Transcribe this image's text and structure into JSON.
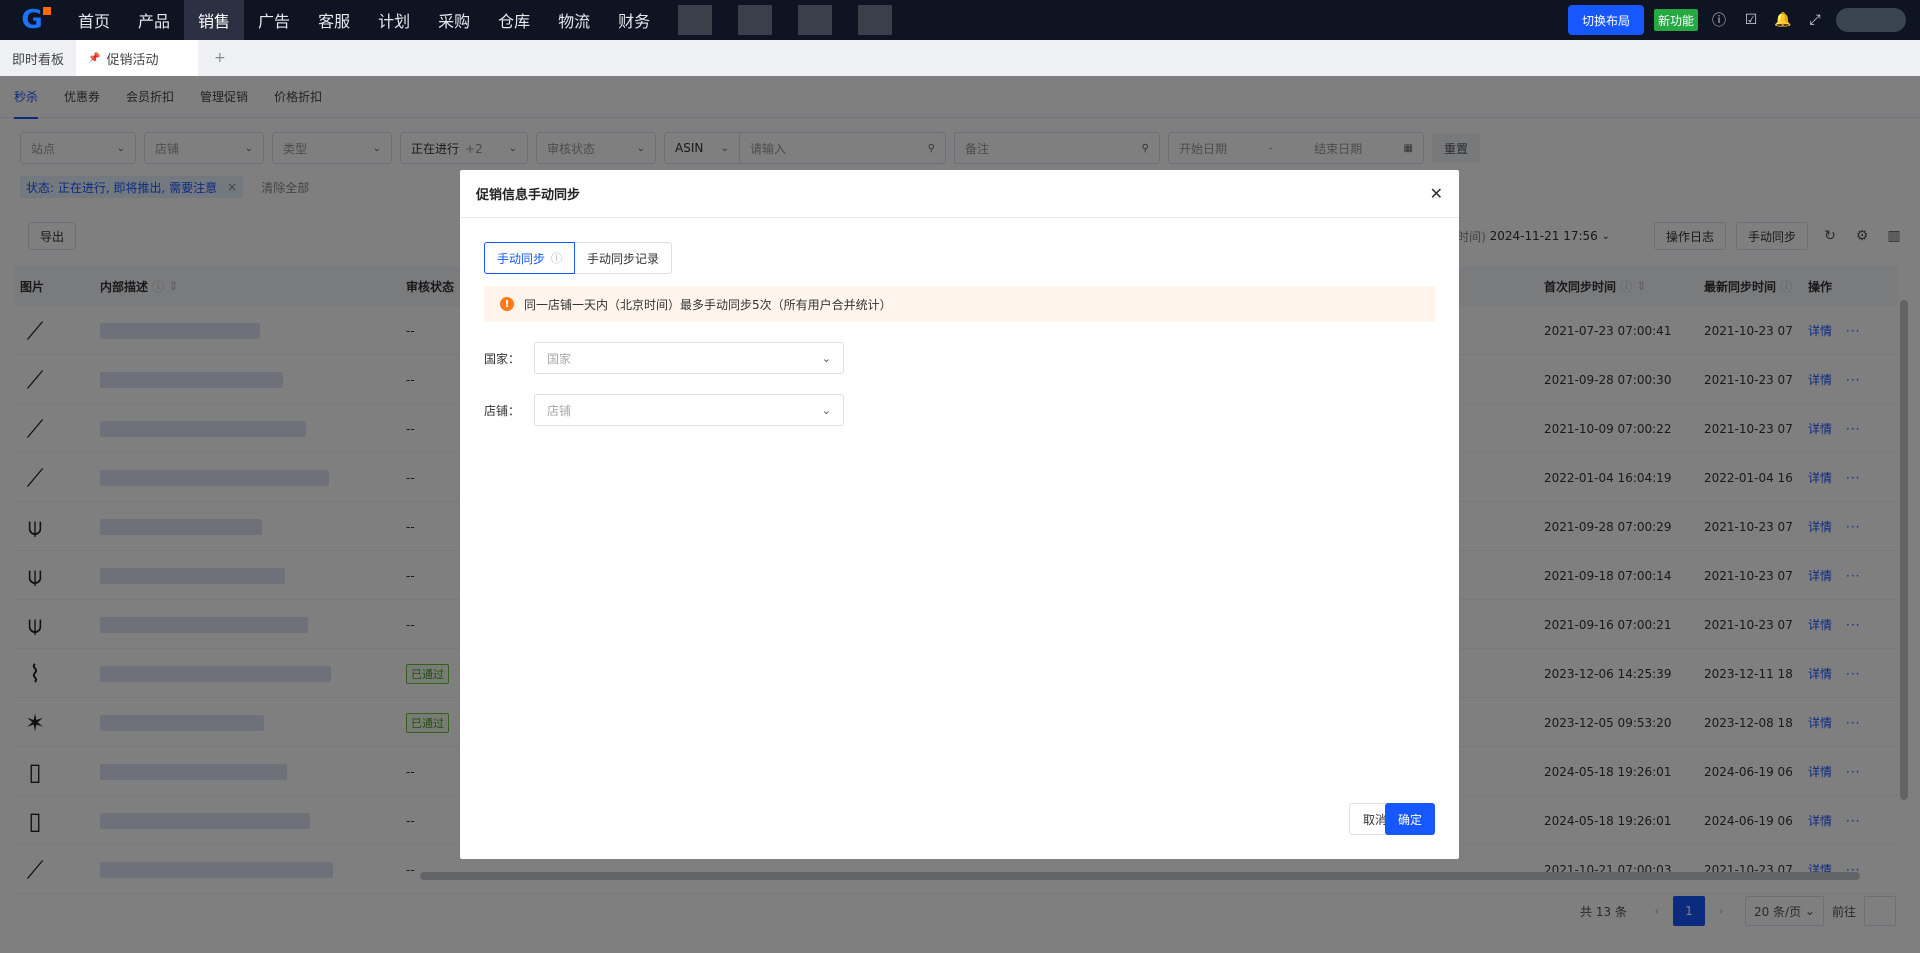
{
  "topnav": {
    "logo": "G",
    "items": [
      "首页",
      "产品",
      "销售",
      "广告",
      "客服",
      "计划",
      "采购",
      "仓库",
      "物流",
      "财务"
    ],
    "active": "销售",
    "switch_layout": "切换布局",
    "new_feature": "新功能"
  },
  "tabstrip": {
    "tabs": [
      "即时看板",
      "促销活动"
    ],
    "add": "+"
  },
  "subtabs": [
    "秒杀",
    "优惠券",
    "会员折扣",
    "管理促销",
    "价格折扣"
  ],
  "filters": {
    "site": "站点",
    "shop": "店铺",
    "type": "类型",
    "status": "正在进行",
    "status_more": "+2",
    "review": "审核状态",
    "asin": "ASIN",
    "input_placeholder": "请输入",
    "remark_placeholder": "备注",
    "start_date": "开始日期",
    "date_sep": "-",
    "end_date": "结束日期",
    "reset": "重置"
  },
  "status_chip": "状态: 正在进行, 即将推出, 需要注意",
  "clear_all": "清除全部",
  "toolbar": {
    "export": "导出",
    "sync_time_prefix": "时间)",
    "sync_time": "2024-11-21 17:56",
    "op_log": "操作日志",
    "manual_sync": "手动同步"
  },
  "table": {
    "headers": [
      "图片",
      "内部描述",
      "审核状态",
      "首次同步时间",
      "最新同步时间",
      "操作"
    ],
    "rows": [
      {
        "review": "--",
        "first": "2021-07-23 07:00:41",
        "latest": "2021-10-23 07"
      },
      {
        "review": "--",
        "first": "2021-09-28 07:00:30",
        "latest": "2021-10-23 07"
      },
      {
        "review": "--",
        "first": "2021-10-09 07:00:22",
        "latest": "2021-10-23 07"
      },
      {
        "review": "--",
        "first": "2022-01-04 16:04:19",
        "latest": "2022-01-04 16"
      },
      {
        "review": "--",
        "first": "2021-09-28 07:00:29",
        "latest": "2021-10-23 07"
      },
      {
        "review": "--",
        "first": "2021-09-18 07:00:14",
        "latest": "2021-10-23 07"
      },
      {
        "review": "--",
        "first": "2021-09-16 07:00:21",
        "latest": "2021-10-23 07"
      },
      {
        "review": "已通过",
        "first": "2023-12-06 14:25:39",
        "latest": "2023-12-11 18"
      },
      {
        "review": "已通过",
        "first": "2023-12-05 09:53:20",
        "latest": "2023-12-08 18"
      },
      {
        "review": "--",
        "first": "2024-05-18 19:26:01",
        "latest": "2024-06-19 06"
      },
      {
        "review": "--",
        "first": "2024-05-18 19:26:01",
        "latest": "2024-06-19 06"
      },
      {
        "review": "--",
        "first": "2021-10-21 07:00:03",
        "latest": "2021-10-23 07"
      }
    ],
    "detail": "详情",
    "more": "···"
  },
  "pager": {
    "total": "共 13 条",
    "page": "1",
    "size": "20 条/页",
    "goto": "前往"
  },
  "modal": {
    "title": "促销信息手动同步",
    "tab_sync": "手动同步",
    "tab_records": "手动同步记录",
    "notice": "同一店铺一天内（北京时间）最多手动同步5次（所有用户合并统计）",
    "country_label": "国家：",
    "country_placeholder": "国家",
    "shop_label": "店铺：",
    "shop_placeholder": "店铺",
    "cancel": "取消",
    "ok": "确定"
  },
  "colors": {
    "primary": "#1657ff",
    "nav_bg": "#0e1421",
    "warn": "#ff7a18",
    "pass": "#67c23a"
  }
}
